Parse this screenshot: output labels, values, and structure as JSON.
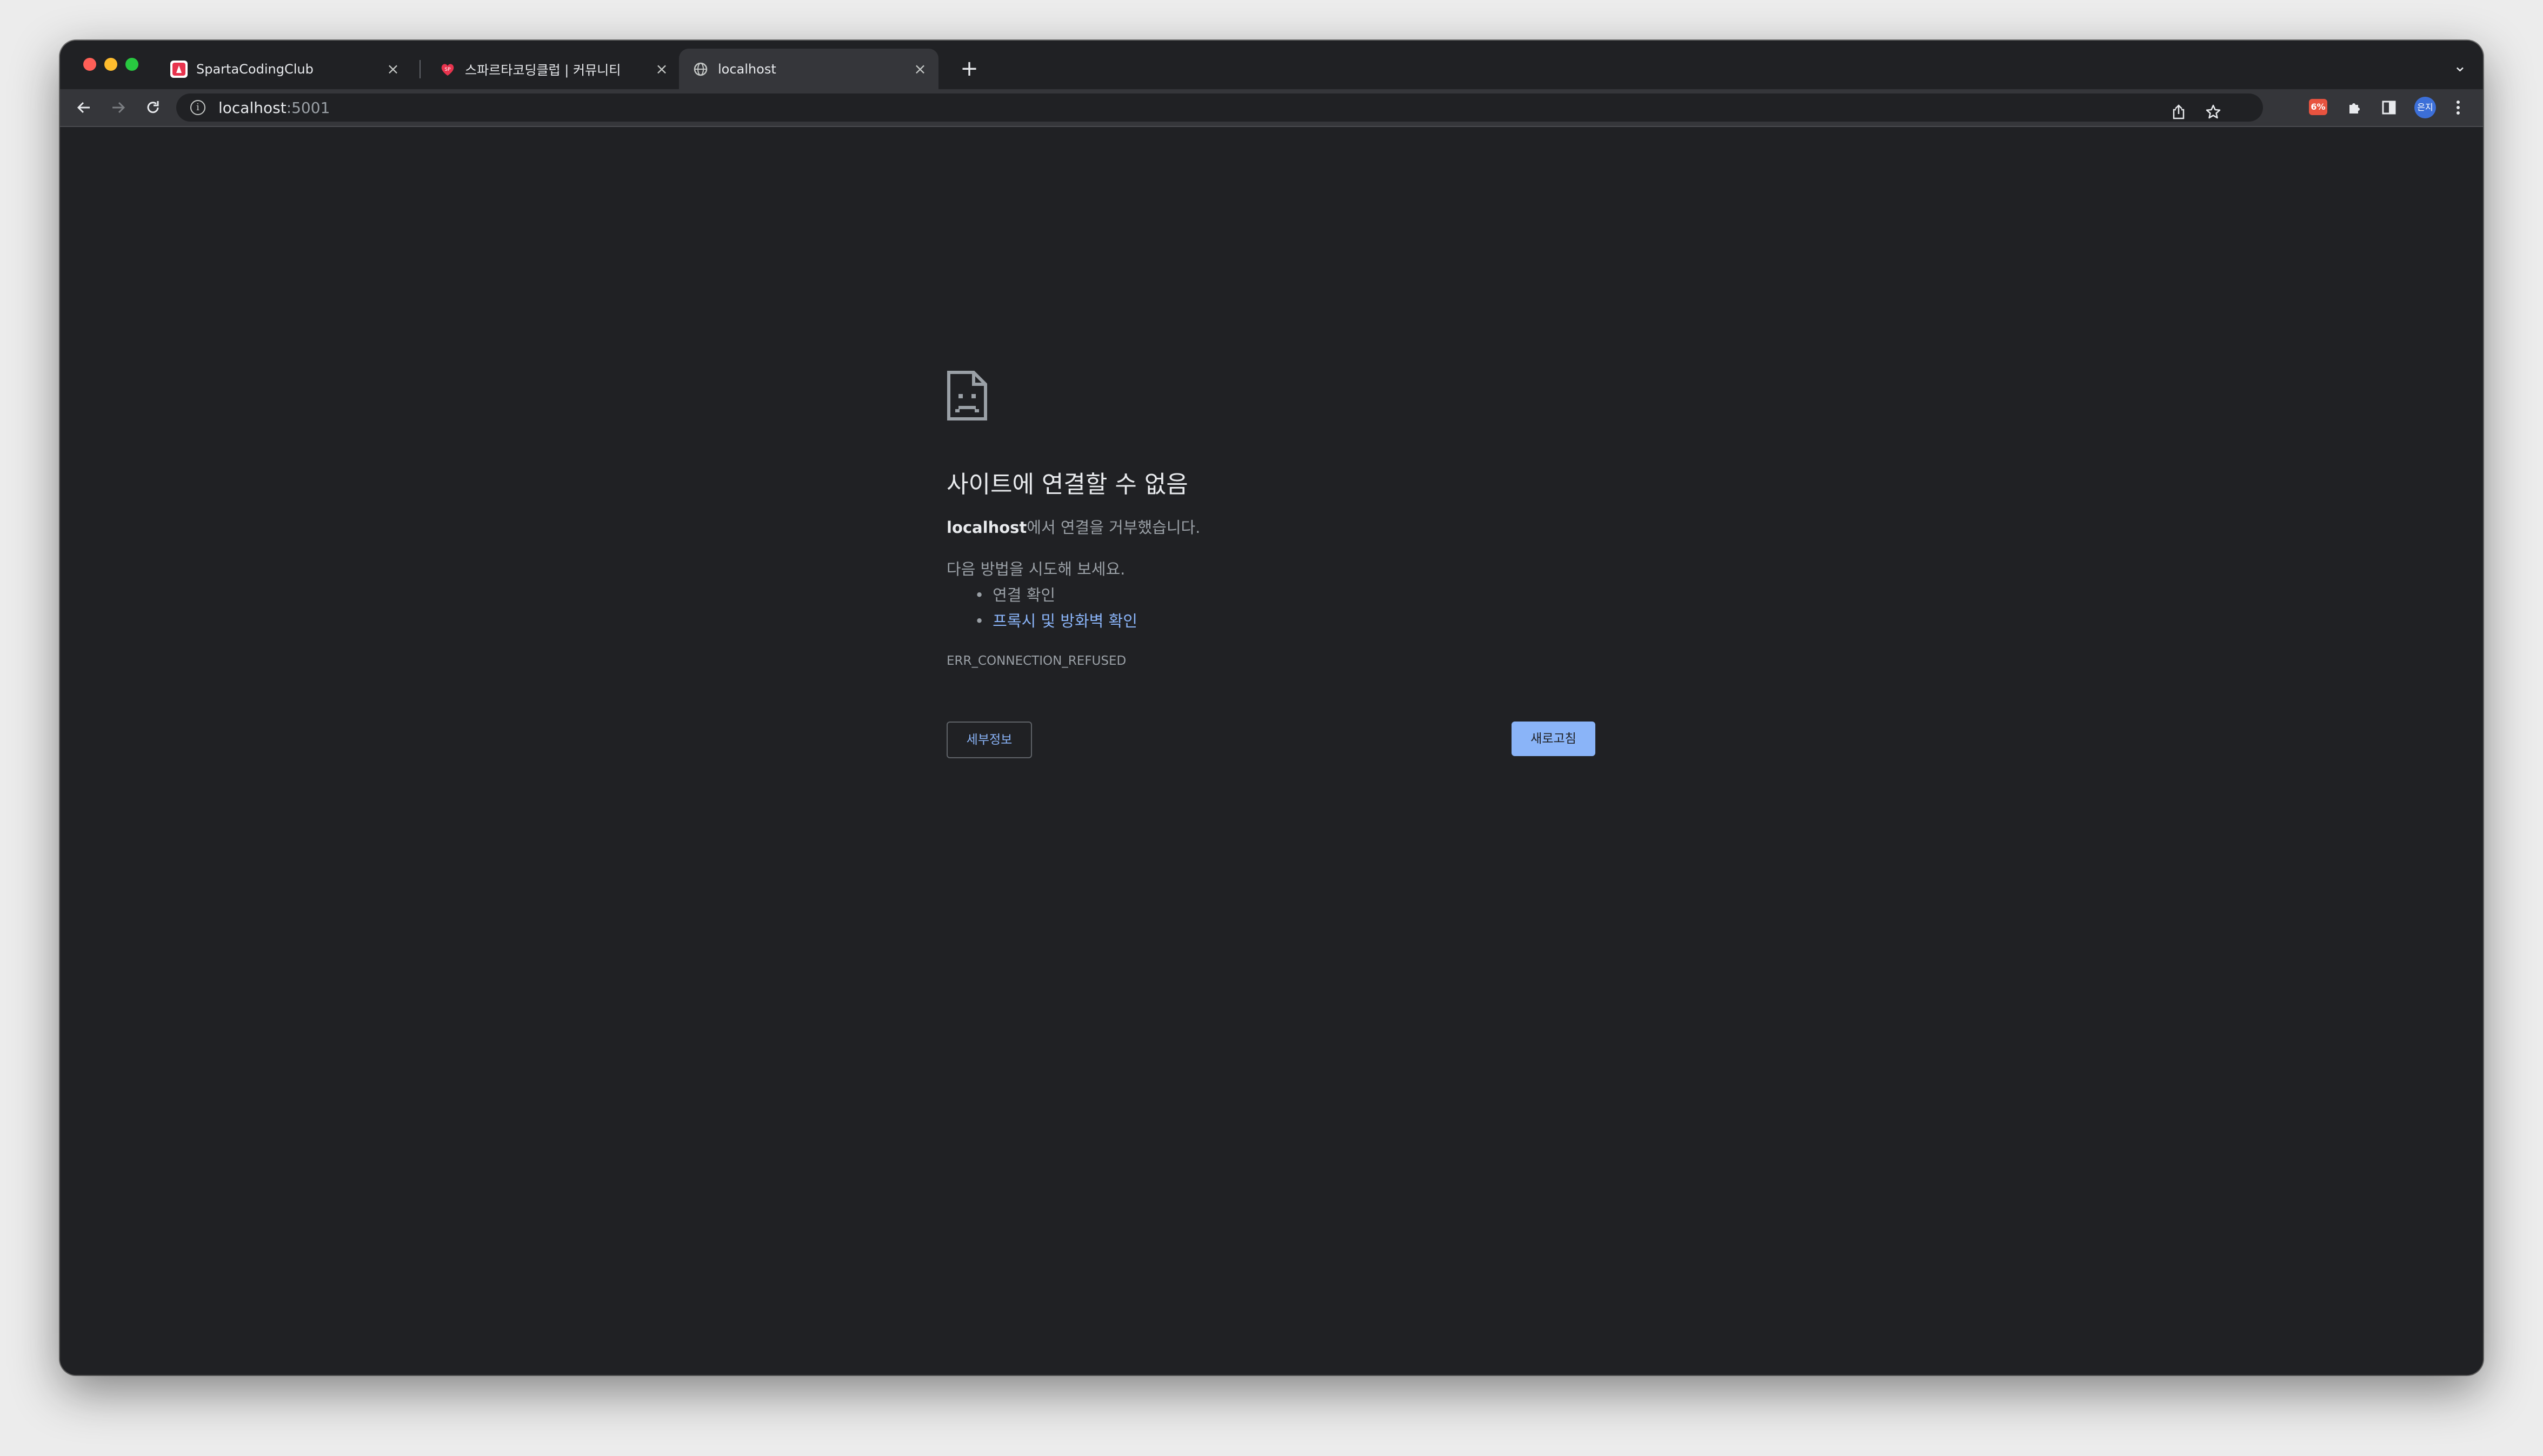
{
  "tabs": [
    {
      "title": "SpartaCodingClub",
      "close": "×"
    },
    {
      "title": "스파르타코딩클럽 | 커뮤니티",
      "close": "×"
    },
    {
      "title": "localhost",
      "close": "×"
    }
  ],
  "tabstrip": {
    "new_tab": "+",
    "menu": "⌄"
  },
  "toolbar": {
    "url_host": "localhost",
    "url_port": ":5001",
    "extension_badge": "6%",
    "profile_initials": "은지"
  },
  "error": {
    "heading": "사이트에 연결할 수 없음",
    "summary_host": "localhost",
    "summary_rest": "에서 연결을 거부했습니다.",
    "try_intro": "다음 방법을 시도해 보세요.",
    "suggestions": [
      "연결 확인",
      "프록시 및 방화벽 확인"
    ],
    "code": "ERR_CONNECTION_REFUSED",
    "details_button": "세부정보",
    "reload_button": "새로고침"
  },
  "colors": {
    "page_bg": "#202124",
    "toolbar_bg": "#35363a",
    "link": "#8ab4f8",
    "text_primary": "#e8eaed",
    "text_secondary": "#9aa0a6"
  },
  "icons": [
    "back-icon",
    "forward-icon",
    "reload-icon",
    "info-icon",
    "share-icon",
    "bookmark-star-icon",
    "extensions-icon",
    "side-panel-icon",
    "more-menu-icon",
    "sad-file-icon"
  ]
}
